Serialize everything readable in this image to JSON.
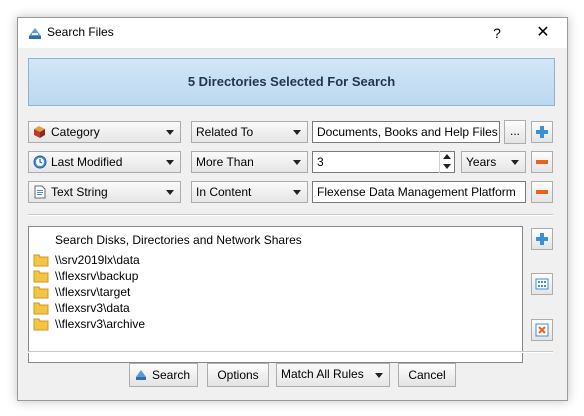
{
  "window": {
    "title": "Search Files",
    "help_label": "?",
    "close_label": "✕"
  },
  "banner": {
    "text": "5 Directories Selected For Search"
  },
  "rules": [
    {
      "field": "Category",
      "field_icon": "category-icon",
      "operator": "Related To",
      "value": "Documents, Books and Help Files",
      "browse_label": "...",
      "action": "add"
    },
    {
      "field": "Last Modified",
      "field_icon": "clock-icon",
      "operator": "More Than",
      "value": "3",
      "unit": "Years",
      "action": "remove"
    },
    {
      "field": "Text String",
      "field_icon": "text-file-icon",
      "operator": "In Content",
      "value": "Flexense Data Management Platform",
      "action": "remove"
    }
  ],
  "locations": {
    "header": "Search Disks, Directories and Network Shares",
    "items": [
      "\\\\srv2019lx\\data",
      "\\\\flexsrv\\backup",
      "\\\\flexsrv\\target",
      "\\\\flexsrv3\\data",
      "\\\\flexsrv3\\archive"
    ]
  },
  "footer": {
    "search_label": "Search",
    "options_label": "Options",
    "match_label": "Match All Rules",
    "cancel_label": "Cancel"
  },
  "colors": {
    "add": "#3a8fd6",
    "remove": "#e8641e",
    "banner_text": "#1f3550"
  }
}
